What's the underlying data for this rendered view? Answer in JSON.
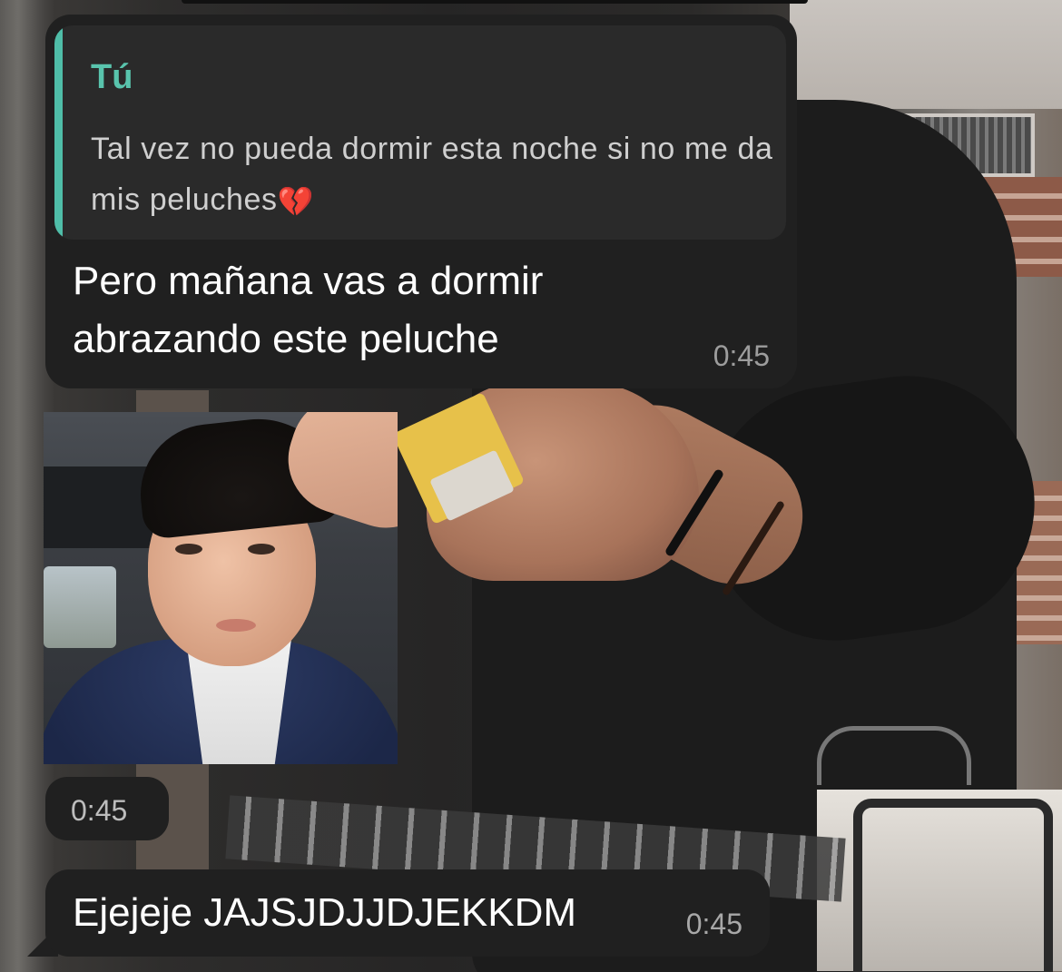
{
  "messages": [
    {
      "reply_to": {
        "author": "Tú",
        "text": "Tal vez no pueda dormir esta noche si no me da mis peluches",
        "emoji": "💔"
      },
      "text": "Pero mañana vas a dormir abrazando este peluche",
      "time": "0:45"
    },
    {
      "type": "image",
      "time": "0:45"
    },
    {
      "text": "Ejejeje JAJSJDJJDJEKKDM",
      "time": "0:45"
    }
  ],
  "colors": {
    "bubble": "#202020",
    "quote_bar": "#4fbda8",
    "quote_author": "#59c4ad",
    "timestamp": "#9d9d9d"
  },
  "icons": [
    "broken-heart-emoji"
  ]
}
